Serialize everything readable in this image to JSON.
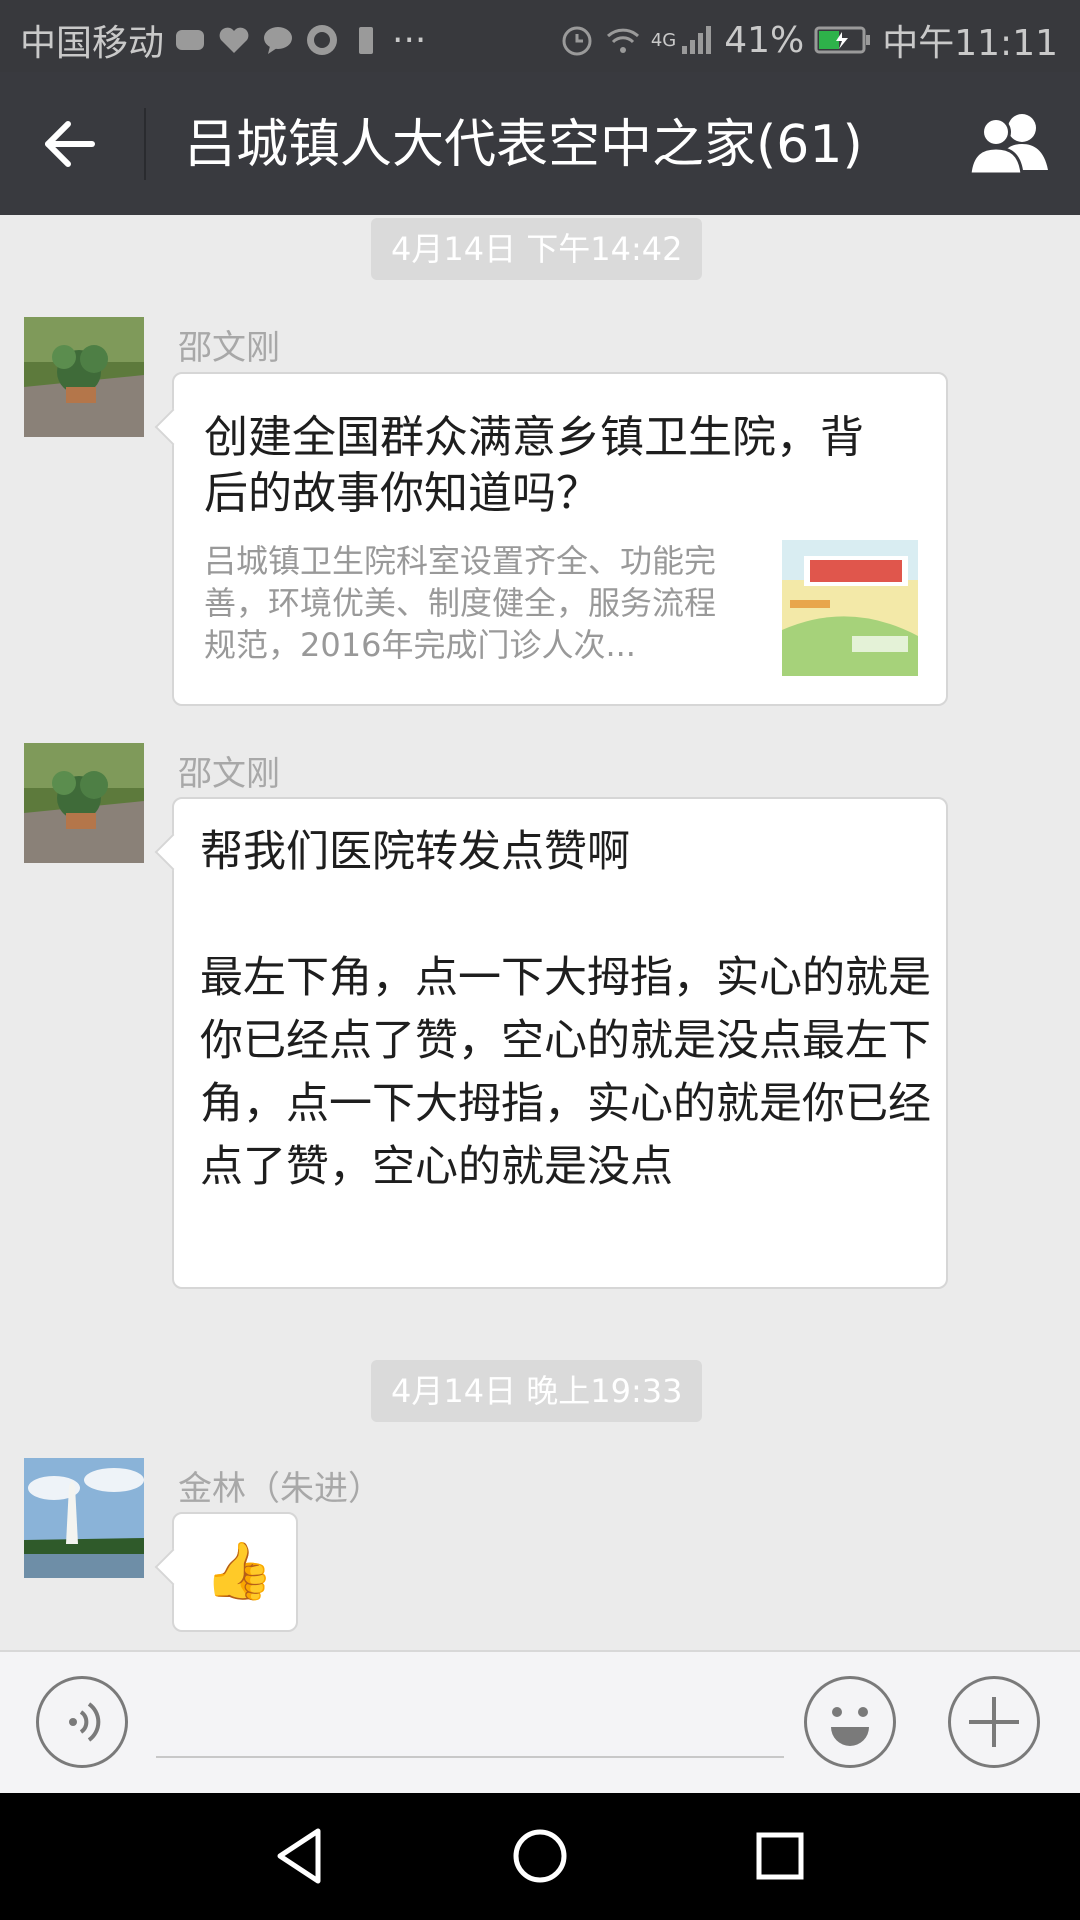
{
  "status_bar": {
    "carrier": "中国移动",
    "network": "4G",
    "battery": "41%",
    "time": "中午11:11"
  },
  "header": {
    "title": "吕城镇人大代表空中之家(61)"
  },
  "messages": [
    {
      "type": "timestamp",
      "text": "4月14日 下午14:42"
    },
    {
      "type": "link",
      "sender": "邵文刚",
      "title": "创建全国群众满意乡镇卫生院，背后的故事你知道吗？",
      "description": "吕城镇卫生院科室设置齐全、功能完善，环境优美、制度健全，服务流程规范，2016年完成门诊人次..."
    },
    {
      "type": "text",
      "sender": "邵文刚",
      "text": "帮我们医院转发点赞啊\n\n最左下角，点一下大拇指，实心的就是你已经点了赞，空心的就是没点最左下角，点一下大拇指，实心的就是你已经点了赞，空心的就是没点"
    },
    {
      "type": "timestamp",
      "text": "4月14日 晚上19:33"
    },
    {
      "type": "emoji",
      "sender": "金林（朱进）",
      "emoji": "👍"
    }
  ],
  "input_bar": {
    "placeholder": ""
  },
  "icons": {
    "back": "arrow-left-icon",
    "group": "group-members-icon",
    "voice": "voice-icon",
    "emoji": "smiley-icon",
    "plus": "plus-icon",
    "nav_back": "triangle-back-icon",
    "nav_home": "circle-home-icon",
    "nav_recent": "square-recent-icon"
  },
  "colors": {
    "title_bar": "#393a3f",
    "status_bar": "#38393d",
    "chat_bg": "#ebebeb",
    "bubble": "#ffffff"
  }
}
